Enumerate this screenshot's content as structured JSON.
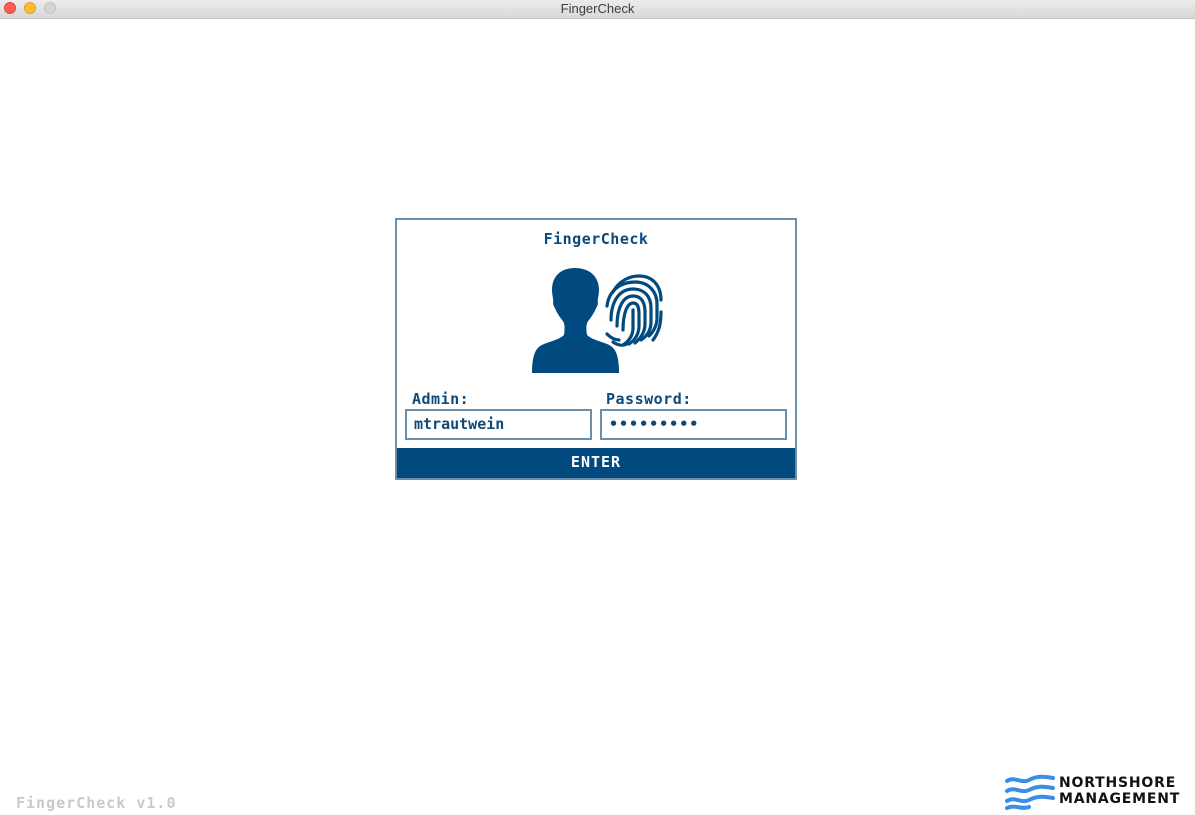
{
  "window": {
    "title": "FingerCheck"
  },
  "login": {
    "title": "FingerCheck",
    "hero_icons": [
      "user-silhouette-icon",
      "fingerprint-icon"
    ],
    "admin_label": "Admin:",
    "admin_value": "mtrautwein",
    "password_label": "Password:",
    "password_value": "•••••••••",
    "enter_label": "ENTER"
  },
  "footer": {
    "version": "FingerCheck v1.0",
    "brand_line1": "NORTHSHORE",
    "brand_line2": "MANAGEMENT",
    "brand_icon": "waves-logo-icon"
  },
  "colors": {
    "accent": "#004a80",
    "border": "#6b8eaa",
    "brand_wave": "#3a8ee6",
    "version_text": "#c9c9c9"
  }
}
